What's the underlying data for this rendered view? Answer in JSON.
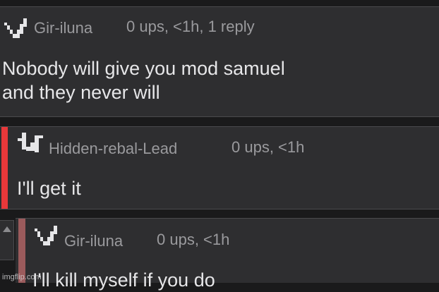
{
  "comments": [
    {
      "username": "Gir-iluna",
      "meta": "0 ups, <1h, 1 reply",
      "body_line1": "Nobody will give you mod samuel",
      "body_line2": "and they never will"
    },
    {
      "username": "Hidden-rebal-Lead",
      "meta": "0 ups, <1h",
      "body_line1": "I'll get it"
    },
    {
      "username": "Gir-iluna",
      "meta": "0 ups, <1h",
      "body_line1": "I'll kill myself if you do"
    }
  ],
  "colors": {
    "reply_bar_active": "#e8383a",
    "reply_bar_nested": "#9b5b5c"
  },
  "icons": {
    "avatar_1": "avatar-v-icon",
    "avatar_2": "avatar-u-icon",
    "avatar_3": "avatar-v-icon",
    "collapse": "triangle-up-icon"
  },
  "watermark": "imgflip.com"
}
